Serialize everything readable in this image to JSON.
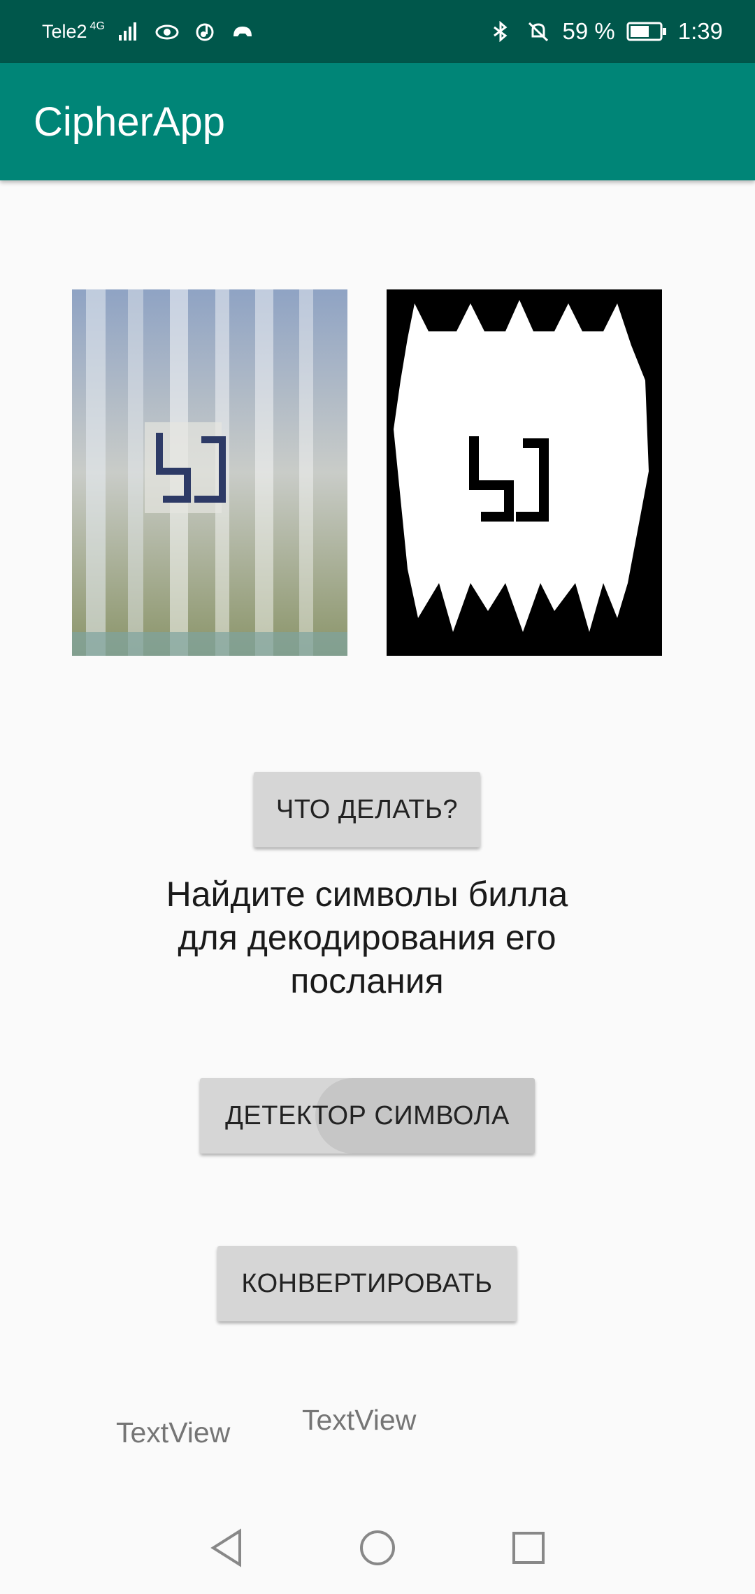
{
  "status_bar": {
    "carrier": "Tele2",
    "network": "4G",
    "battery_percent": "59 %",
    "time": "1:39",
    "icons": [
      "signal-icon",
      "eye-icon",
      "music-icon",
      "game-icon",
      "bluetooth-icon",
      "mute-icon",
      "battery-icon"
    ]
  },
  "app_bar": {
    "title": "CipherApp"
  },
  "images": {
    "original": "camera-photo-of-symbol",
    "processed": "binarized-symbol-image"
  },
  "buttons": {
    "what_to_do": "ЧТО ДЕЛАТЬ?",
    "detect_symbol": "ДЕТЕКТОР СИМВОЛА",
    "convert": "КОНВЕРТИРОВАТЬ"
  },
  "message": "Найдите символы билла для декодирования его послания",
  "text_views": [
    "TextView",
    "TextView"
  ],
  "nav_bar": {
    "icons": [
      "back-icon",
      "home-icon",
      "recents-icon"
    ]
  },
  "colors": {
    "status_bar": "#00574b",
    "app_bar": "#008577",
    "button": "#d6d6d6",
    "background": "#fafafa"
  }
}
